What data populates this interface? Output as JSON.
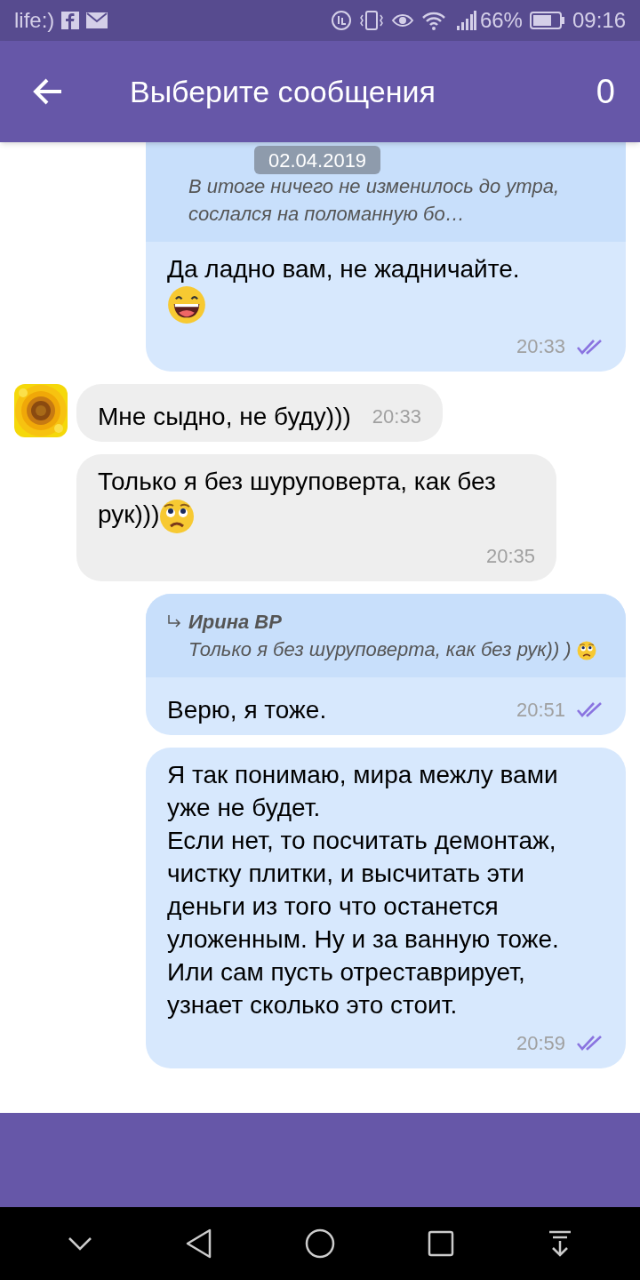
{
  "status_bar": {
    "carrier": "life:)",
    "battery": "66%",
    "time": "09:16"
  },
  "header": {
    "title": "Выберите сообщения",
    "count": "0"
  },
  "date_pill": "02.04.2019",
  "messages": [
    {
      "kind": "sent",
      "quote": {
        "text": "В итоге ничего не изменилось до утра, сослался на поломанную бо…"
      },
      "text": "Да ладно вам, не жадничайте.",
      "emoji": {
        "kind": "laughing",
        "line_break": true
      },
      "time": "20:33",
      "read": true
    },
    {
      "kind": "received",
      "avatar": true,
      "text": "Мне сыдно, не буду)))",
      "time": "20:33"
    },
    {
      "kind": "received",
      "text": "Только я без шуруповерта, как без рук)))",
      "emoji": {
        "kind": "worried",
        "line_break": false
      },
      "time": "20:35"
    },
    {
      "kind": "sent",
      "quote": {
        "author": "Ирина ВР",
        "text": "Только я без шуруповерта, как без рук)) )",
        "emoji": {
          "kind": "worried"
        }
      },
      "text": "Верю, я тоже.",
      "time": "20:51",
      "read": true
    },
    {
      "kind": "sent",
      "text": "Я так понимаю, мира межлу вами уже не будет.\nЕсли нет, то посчитать демонтаж, чистку плитки, и высчитать эти деньги из того что останется уложенным. Ну и за ванную тоже. Или сам пусть отреставрирует, узнает сколько это стоит.",
      "time": "20:59",
      "read": true
    }
  ]
}
